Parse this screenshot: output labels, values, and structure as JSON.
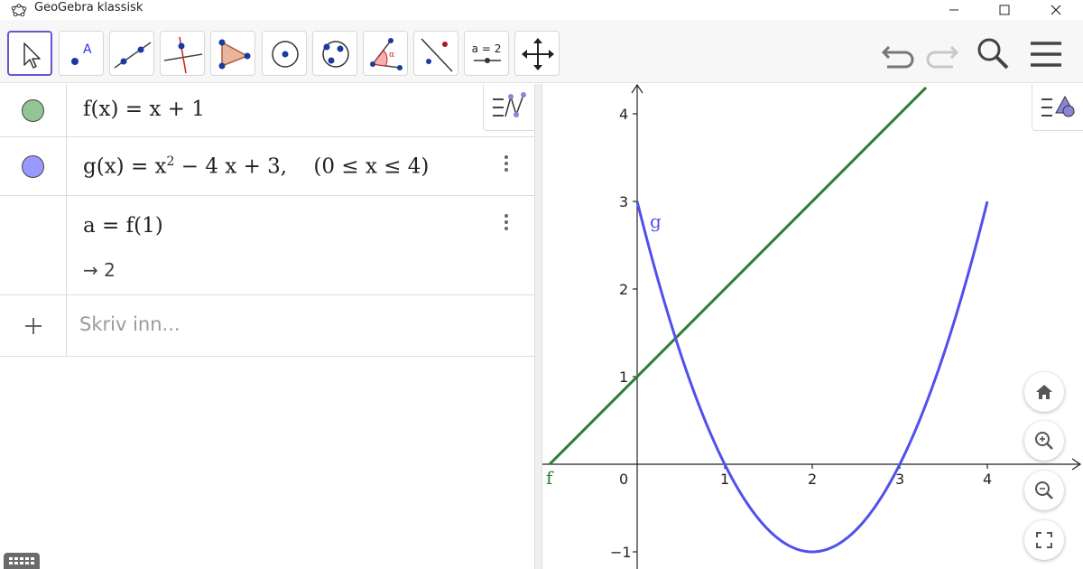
{
  "window": {
    "title": "GeoGebra klassisk"
  },
  "toolbar": {
    "tools": [
      "move",
      "point",
      "line",
      "perpendicular-line",
      "polygon",
      "circle-center-point",
      "circle-three-points",
      "angle",
      "reflect",
      "slider",
      "move-graphics-view"
    ],
    "slider_label": "a = 2",
    "active_tool": "move"
  },
  "algebra": {
    "rows": [
      {
        "color": "#93c594",
        "lhs": "f(x)",
        "eq": " = ",
        "rhs": "x + 1"
      },
      {
        "color": "#999aff",
        "lhs": "g(x)",
        "eq": " = ",
        "rhs_pre": "x",
        "rhs_exp": "2",
        "rhs_post": " − 4 x + 3,",
        "condition": "(0 ≤ x ≤ 4)"
      },
      {
        "lhs": "a",
        "eq": " = ",
        "rhs": "f(1)",
        "result": "→ 2"
      }
    ],
    "input_placeholder": "Skriv inn..."
  },
  "graphics": {
    "x_ticks": [
      "0",
      "1",
      "2",
      "3",
      "4"
    ],
    "y_ticks": [
      "4",
      "3",
      "2",
      "1",
      "−1"
    ],
    "label_f": "f",
    "label_g": "g",
    "color_f": "#2e7d32",
    "color_g": "#5050ee"
  },
  "chart_data": {
    "type": "line",
    "xlim": [
      -1,
      5
    ],
    "ylim": [
      -1.2,
      4.3
    ],
    "grid": false,
    "series": [
      {
        "name": "f",
        "expression": "x + 1",
        "x": [
          -1,
          3.3
        ],
        "y": [
          0,
          4.3
        ]
      },
      {
        "name": "g",
        "expression": "x^2 - 4x + 3",
        "x": [
          0,
          0.5,
          1,
          1.5,
          2,
          2.5,
          3,
          3.5,
          4
        ],
        "y": [
          3,
          1.25,
          0,
          -0.75,
          -1,
          -0.75,
          0,
          1.25,
          3
        ]
      }
    ]
  }
}
